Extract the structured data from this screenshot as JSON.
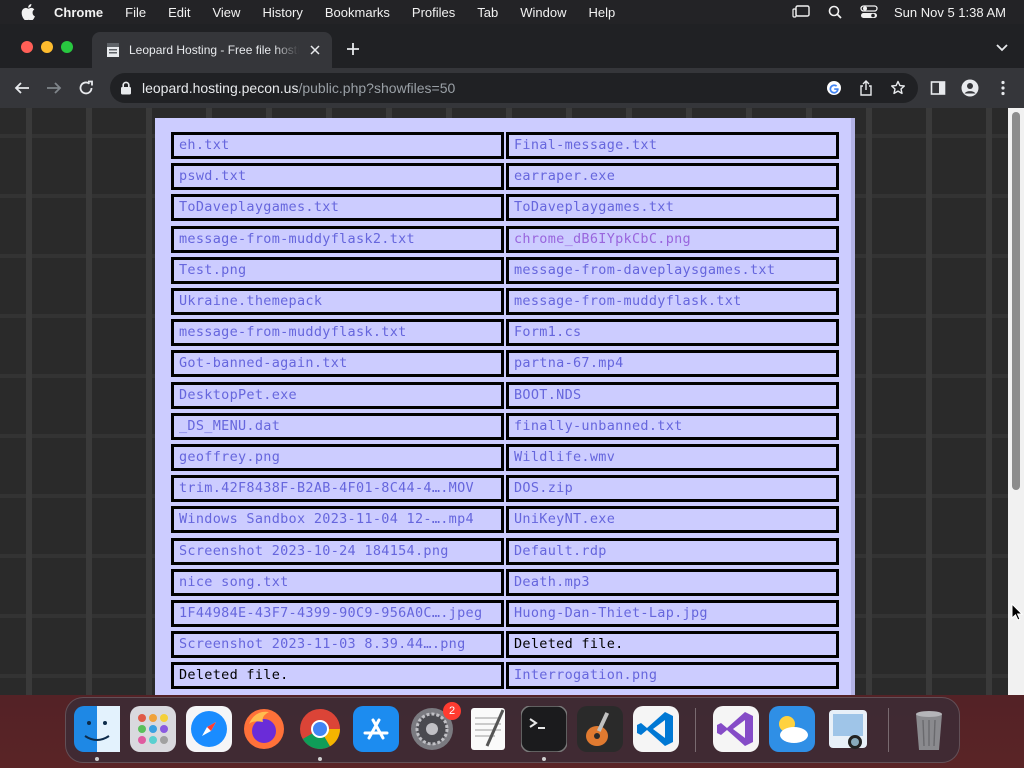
{
  "menubar": {
    "app_name": "Chrome",
    "items": [
      "File",
      "Edit",
      "View",
      "History",
      "Bookmarks",
      "Profiles",
      "Tab",
      "Window",
      "Help"
    ],
    "clock": "Sun Nov 5  1:38 AM",
    "status_icons": [
      "stage-manager-icon",
      "spotlight-icon",
      "control-center-icon"
    ]
  },
  "browser": {
    "tab_title": "Leopard Hosting - Free file hosting",
    "url_host": "leopard.hosting.pecon.us",
    "url_path": "/public.php?showfiles=50"
  },
  "files": [
    {
      "name": "eh.txt",
      "state": "link"
    },
    {
      "name": "Final-message.txt",
      "state": "link"
    },
    {
      "name": "pswd.txt",
      "state": "link"
    },
    {
      "name": "earraper.exe",
      "state": "link"
    },
    {
      "name": "ToDaveplaygames.txt",
      "state": "link"
    },
    {
      "name": "ToDaveplaygames.txt",
      "state": "link"
    },
    {
      "name": "message-from-muddyflask2.txt",
      "state": "link"
    },
    {
      "name": "chrome_dB6IYpkCbC.png",
      "state": "visited"
    },
    {
      "name": "Test.png",
      "state": "link"
    },
    {
      "name": "message-from-daveplaysgames.txt",
      "state": "link"
    },
    {
      "name": "Ukraine.themepack",
      "state": "link"
    },
    {
      "name": "message-from-muddyflask.txt",
      "state": "link"
    },
    {
      "name": "message-from-muddyflask.txt",
      "state": "link"
    },
    {
      "name": "Form1.cs",
      "state": "link"
    },
    {
      "name": "Got-banned-again.txt",
      "state": "link"
    },
    {
      "name": "partna-67.mp4",
      "state": "link"
    },
    {
      "name": "DesktopPet.exe",
      "state": "link"
    },
    {
      "name": "BOOT.NDS",
      "state": "link"
    },
    {
      "name": "_DS_MENU.dat",
      "state": "link"
    },
    {
      "name": "finally-unbanned.txt",
      "state": "link"
    },
    {
      "name": "geoffrey.png",
      "state": "link"
    },
    {
      "name": "Wildlife.wmv",
      "state": "link"
    },
    {
      "name": "trim.42F8438F-B2AB-4F01-8C44-4….MOV",
      "state": "link"
    },
    {
      "name": "DOS.zip",
      "state": "link"
    },
    {
      "name": "Windows Sandbox 2023-11-04 12-….mp4",
      "state": "link"
    },
    {
      "name": "UniKeyNT.exe",
      "state": "link"
    },
    {
      "name": "Screenshot 2023-10-24 184154.png",
      "state": "link"
    },
    {
      "name": "Default.rdp",
      "state": "link"
    },
    {
      "name": "nice song.txt",
      "state": "link"
    },
    {
      "name": "Death.mp3",
      "state": "link"
    },
    {
      "name": "1F44984E-43F7-4399-90C9-956A0C….jpeg",
      "state": "link"
    },
    {
      "name": "Huong-Dan-Thiet-Lap.jpg",
      "state": "link"
    },
    {
      "name": "Screenshot 2023-11-03 8.39.44….png",
      "state": "link"
    },
    {
      "name": "Deleted file.",
      "state": "deleted"
    },
    {
      "name": "Deleted file.",
      "state": "deleted"
    },
    {
      "name": "Interrogation.png",
      "state": "link"
    }
  ],
  "dock": {
    "apps": [
      {
        "icon": "finder-icon",
        "running": true,
        "badge": ""
      },
      {
        "icon": "launchpad-icon",
        "running": false,
        "badge": ""
      },
      {
        "icon": "safari-icon",
        "running": false,
        "badge": ""
      },
      {
        "icon": "firefox-icon",
        "running": false,
        "badge": ""
      },
      {
        "icon": "chrome-icon",
        "running": true,
        "badge": ""
      },
      {
        "icon": "app-store-icon",
        "running": false,
        "badge": ""
      },
      {
        "icon": "system-settings-icon",
        "running": false,
        "badge": "2"
      },
      {
        "icon": "textedit-icon",
        "running": false,
        "badge": ""
      },
      {
        "icon": "terminal-icon",
        "running": true,
        "badge": ""
      },
      {
        "icon": "garageband-icon",
        "running": false,
        "badge": ""
      },
      {
        "icon": "vscode-icon",
        "running": false,
        "badge": ""
      },
      {
        "icon": "visual-studio-icon",
        "running": false,
        "badge": ""
      },
      {
        "icon": "weather-icon",
        "running": false,
        "badge": ""
      },
      {
        "icon": "preview-icon",
        "running": false,
        "badge": ""
      },
      {
        "icon": "trash-icon",
        "running": false,
        "badge": ""
      }
    ]
  }
}
